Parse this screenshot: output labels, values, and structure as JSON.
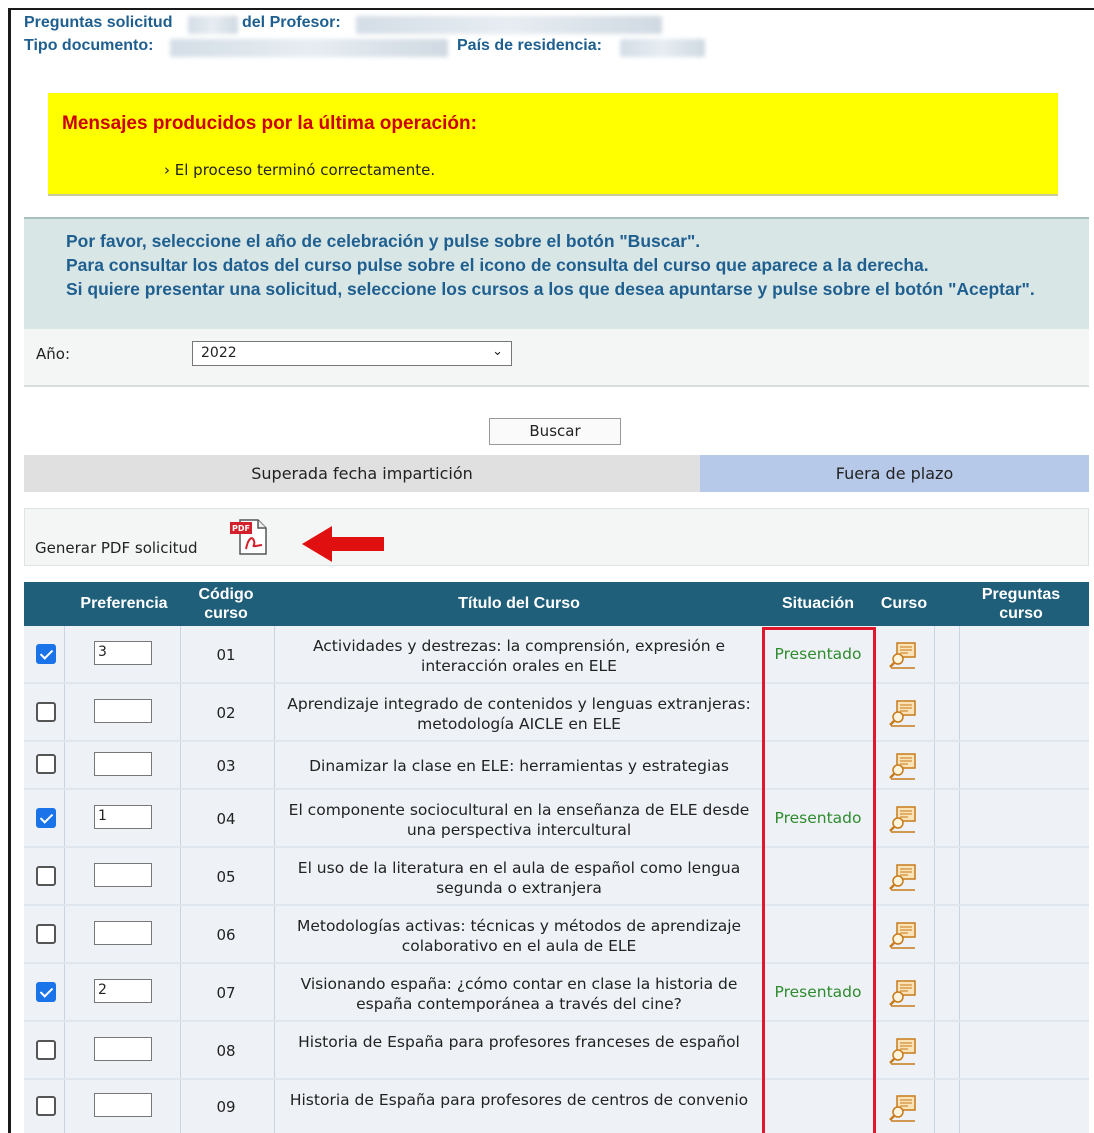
{
  "header": {
    "line1_prefix": "Preguntas solicitud",
    "line1_mid": "del Profesor:",
    "line2_prefix": "Tipo documento:",
    "line2_mid": "País de residencia:"
  },
  "message": {
    "title": "Mensajes producidos por la última operación:",
    "line": "› El proceso terminó correctamente."
  },
  "instructions": {
    "l1": "Por favor, seleccione el año de celebración y pulse sobre el botón \"Buscar\".",
    "l2": "Para consultar los datos del curso pulse sobre el icono de consulta del curso que aparece a la derecha.",
    "l3": "Si quiere presentar una solicitud, seleccione los cursos a los que desea apuntarse y pulse sobre el botón \"Aceptar\"."
  },
  "year": {
    "label": "Año:",
    "value": "2022"
  },
  "search_button": "Buscar",
  "tabs": {
    "left": "Superada fecha impartición",
    "right": "Fuera de plazo"
  },
  "pdf": {
    "label": "Generar PDF solicitud",
    "icon": "pdf-icon"
  },
  "table": {
    "headers": {
      "preferencia": "Preferencia",
      "codigo_1": "Código",
      "codigo_2": "curso",
      "titulo": "Título del Curso",
      "situacion": "Situación",
      "curso": "Curso",
      "preguntas_1": "Preguntas",
      "preguntas_2": "curso"
    },
    "rows": [
      {
        "checked": true,
        "pref": "3",
        "code": "01",
        "title": "Actividades y destrezas: la comprensión, expresión e interacción orales en ELE",
        "status": "Presentado"
      },
      {
        "checked": false,
        "pref": "",
        "code": "02",
        "title": "Aprendizaje integrado de contenidos y lenguas extranjeras: metodología AICLE en ELE",
        "status": ""
      },
      {
        "checked": false,
        "pref": "",
        "code": "03",
        "title": "Dinamizar la clase en ELE: herramientas y estrategias",
        "status": ""
      },
      {
        "checked": true,
        "pref": "1",
        "code": "04",
        "title": "El componente sociocultural en la enseñanza de ELE desde una perspectiva intercultural",
        "status": "Presentado"
      },
      {
        "checked": false,
        "pref": "",
        "code": "05",
        "title": "El uso de la literatura en el aula de español como lengua segunda o extranjera",
        "status": ""
      },
      {
        "checked": false,
        "pref": "",
        "code": "06",
        "title": "Metodologías activas: técnicas y métodos de aprendizaje colaborativo en el aula de ELE",
        "status": ""
      },
      {
        "checked": true,
        "pref": "2",
        "code": "07",
        "title": "Visionando españa: ¿cómo contar en clase la historia de españa contemporánea a través del cine?",
        "status": "Presentado"
      },
      {
        "checked": false,
        "pref": "",
        "code": "08",
        "title": "Historia de España para profesores franceses de español",
        "status": ""
      },
      {
        "checked": false,
        "pref": "",
        "code": "09",
        "title": "Historia de España para profesores de centros de convenio",
        "status": ""
      }
    ]
  },
  "colors": {
    "accent": "#1f5f7a",
    "highlight": "#e0182d",
    "presentado": "#2e8b2e"
  }
}
